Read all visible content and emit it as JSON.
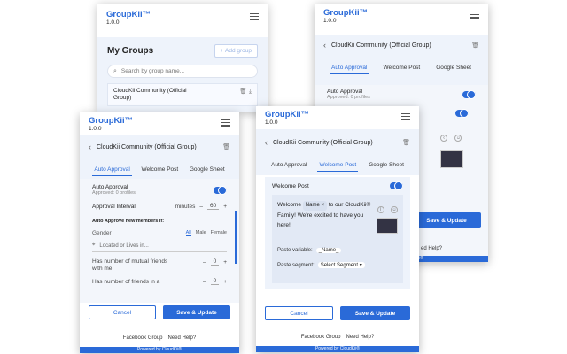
{
  "brand": {
    "name": "GroupKii™",
    "version": "1.0.0"
  },
  "colors": {
    "accent": "#2a6ad8",
    "subheader_bg": "#eef3fb"
  },
  "icons": {
    "menu": "hamburger-icon",
    "back": "chevron-left-icon",
    "delete": "trash-icon",
    "download": "download-icon",
    "search": "search-icon",
    "location": "pin-icon",
    "attach": "paperclip-icon",
    "emoji": "emoji-icon"
  },
  "groups_screen": {
    "title": "My Groups",
    "add_button": "+ Add group",
    "search_placeholder": "Search by group name...",
    "group_name": "CloudKii Community (Official Group)"
  },
  "group": {
    "name": "CloudKii Community (Official Group)"
  },
  "tabs": {
    "auto_approval": "Auto Approval",
    "welcome_post": "Welcome Post",
    "google_sheet": "Google Sheet"
  },
  "auto_approval": {
    "title": "Auto Approval",
    "approved_count": "Approved: 0 profiles",
    "interval_label": "Approval Interval",
    "interval_unit": "minutes",
    "interval_value": "60",
    "auto_approve_heading": "Auto Approve new members if:",
    "gender_label": "Gender",
    "gender_options": {
      "all": "All",
      "male": "Male",
      "female": "Female"
    },
    "location_placeholder": "Located or Lives in...",
    "mutual_friends_label": "Has number of mutual friends with me",
    "mutual_friends_value": "0",
    "friends_label": "Has number of friends in a",
    "friends_value": "0"
  },
  "welcome_post": {
    "title": "Welcome Post",
    "msg_prefix": "Welcome",
    "name_chip": "Name",
    "chip_close": "×",
    "msg_mid": "to our",
    "msg_rest": "CloudKii® Family! We're excited to have you here!",
    "paste_variable_label": "Paste variable:",
    "paste_variable_chip": "_Name_",
    "paste_segment_label": "Paste segment:",
    "paste_segment_value": "Select Segment"
  },
  "buttons": {
    "cancel": "Cancel",
    "save": "Save & Update"
  },
  "footer": {
    "facebook_group": "Facebook Group",
    "need_help": "Need Help?",
    "need_help_short": "ed Help?",
    "powered": "Powered by CloudKii®"
  }
}
